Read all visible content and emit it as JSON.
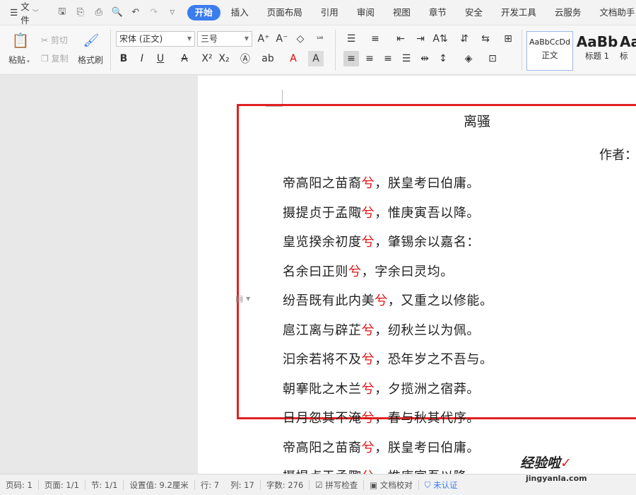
{
  "menubar": {
    "file_label": "文件",
    "tabs": [
      "开始",
      "插入",
      "页面布局",
      "引用",
      "审阅",
      "视图",
      "章节",
      "安全",
      "开发工具",
      "云服务",
      "文档助手"
    ]
  },
  "ribbon": {
    "paste": "粘贴",
    "cut": "剪切",
    "copy": "复制",
    "format_painter": "格式刷",
    "font_name": "宋体 (正文)",
    "font_size": "三号",
    "styles": [
      {
        "sample": "AaBbCcDd",
        "name": "正文"
      },
      {
        "sample": "AaBb",
        "name": "标题 1"
      },
      {
        "sample": "Aa",
        "name": "标"
      }
    ]
  },
  "document": {
    "title": "离骚",
    "author_label": "作者：",
    "highlight_char": "兮",
    "highlight_color": "#e01010",
    "lines": [
      {
        "pre": "帝高阳之苗裔",
        "post": "，朕皇考曰伯庸。"
      },
      {
        "pre": "摄提贞于孟陬",
        "post": "，惟庚寅吾以降。"
      },
      {
        "pre": "皇览揆余初度",
        "post": "，肇锡余以嘉名："
      },
      {
        "pre": "名余曰正则",
        "post": "，字余曰灵均。"
      },
      {
        "pre": "纷吾既有此内美",
        "post": "，又重之以修能。"
      },
      {
        "pre": "扈江离与辟芷",
        "post": "，纫秋兰以为佩。"
      },
      {
        "pre": "汩余若将不及",
        "post": "，恐年岁之不吾与。"
      },
      {
        "pre": "朝搴阰之木兰",
        "post": "，夕揽洲之宿莽。"
      },
      {
        "pre": "日月忽其不淹",
        "post": "，春与秋其代序。"
      },
      {
        "pre": "帝高阳之苗裔",
        "post": "，朕皇考曰伯庸。"
      },
      {
        "pre": "摄提贞于孟陬",
        "post": "，惟庚寅吾以降。"
      }
    ]
  },
  "statusbar": {
    "page_num": "页码: 1",
    "page_total": "页面: 1/1",
    "section": "节: 1/1",
    "setting": "设置值: 9.2厘米",
    "row": "行: 7",
    "col": "列: 17",
    "word_count": "字数: 276",
    "spell_check": "拼写检查",
    "doc_proof": "文档校对",
    "unverified": "未认证"
  },
  "watermark": {
    "text": "经验啦",
    "url": "jingyanla.com"
  }
}
